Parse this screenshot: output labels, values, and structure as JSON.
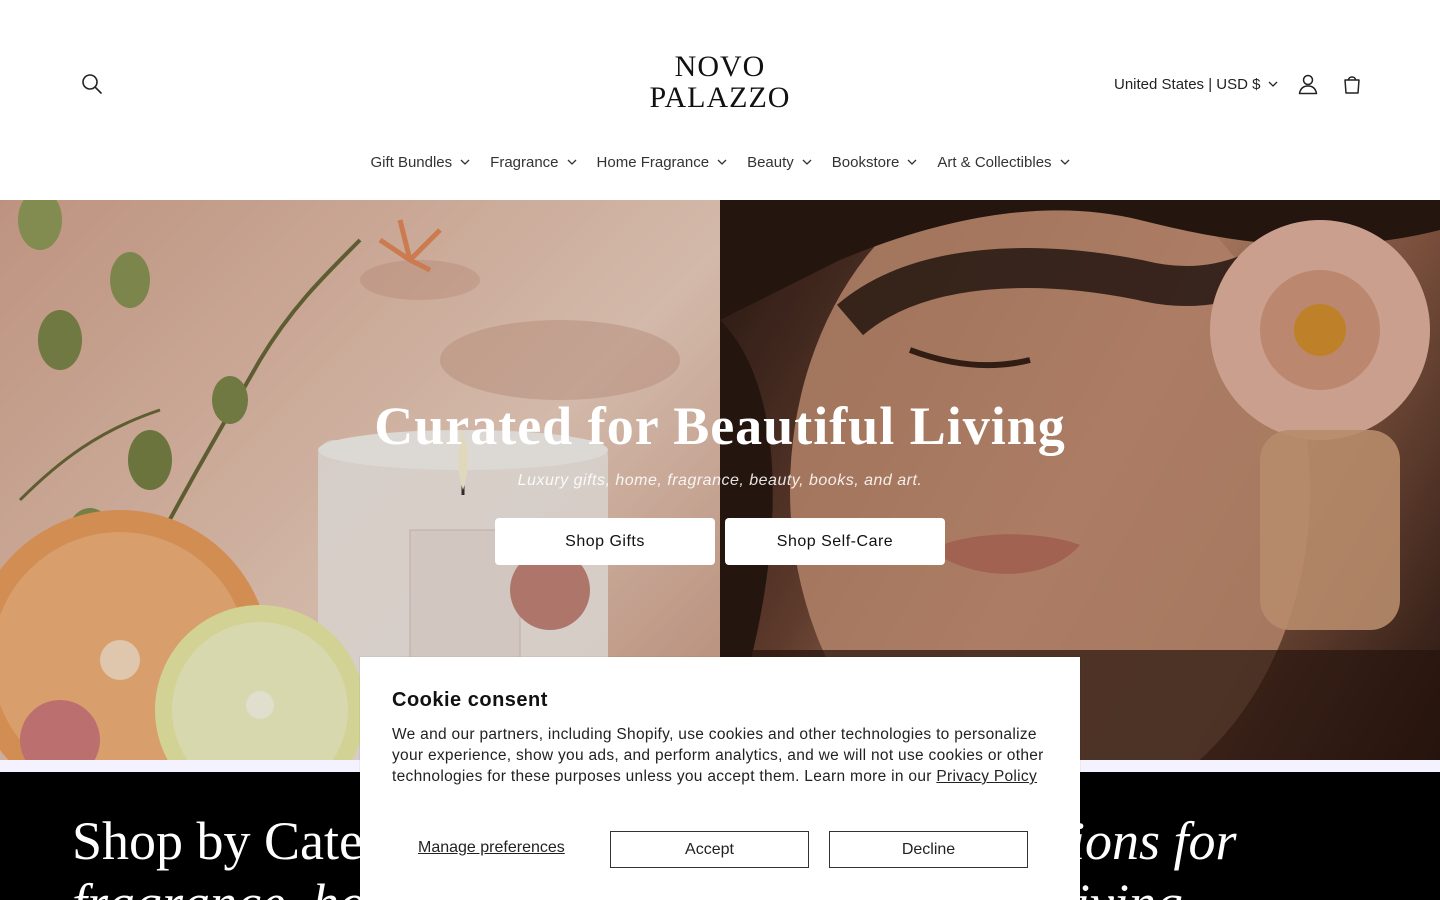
{
  "header": {
    "logo_line1": "NOVO",
    "logo_line2": "PALAZZO",
    "country_selector": "United States | USD $",
    "icons": {
      "search": "search-icon",
      "account": "account-icon",
      "cart": "cart-icon"
    }
  },
  "nav": {
    "items": [
      {
        "label": "Gift Bundles"
      },
      {
        "label": "Fragrance"
      },
      {
        "label": "Home Fragrance"
      },
      {
        "label": "Beauty"
      },
      {
        "label": "Bookstore"
      },
      {
        "label": "Art & Collectibles"
      }
    ]
  },
  "hero": {
    "title": "Curated for Beautiful Living",
    "subtitle": "Luxury gifts, home, fragrance, beauty, books, and art.",
    "buttons": {
      "gifts": "Shop Gifts",
      "selfcare": "Shop Self-Care"
    }
  },
  "category_band": {
    "title_line1": "Shop by Categ",
    "title_line2": "fragrance, ho",
    "right_line1": "ions for",
    "right_line2": "living"
  },
  "cookie": {
    "title": "Cookie consent",
    "text": "We and our partners, including Shopify, use cookies and other technologies to personalize your experience, show you ads, and perform analytics, and we will not use cookies or other technologies for these purposes unless you accept them. Learn more in our ",
    "link": "Privacy Policy",
    "manage": "Manage preferences",
    "accept": "Accept",
    "decline": "Decline"
  },
  "colors": {
    "band_bg": "#000000",
    "divider": "#f5f2ff",
    "text": "#121212"
  }
}
